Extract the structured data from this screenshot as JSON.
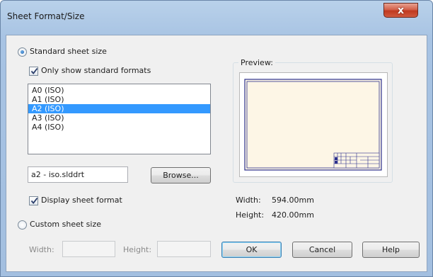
{
  "window": {
    "title": "Sheet Format/Size",
    "close_glyph": "x"
  },
  "standard": {
    "radio_label": "Standard sheet size",
    "selected": true,
    "only_standard_label": "Only show standard formats",
    "only_standard_checked": true,
    "formats": [
      "A0 (ISO)",
      "A1 (ISO)",
      "A2 (ISO)",
      "A3 (ISO)",
      "A4 (ISO)"
    ],
    "selected_format": "A2 (ISO)",
    "template_file": "a2 - iso.slddrt",
    "browse_label": "Browse...",
    "display_format_label": "Display sheet format",
    "display_format_checked": true
  },
  "custom": {
    "radio_label": "Custom sheet size",
    "selected": false,
    "width_label": "Width:",
    "height_label": "Height:",
    "width_value": "",
    "height_value": ""
  },
  "preview": {
    "label": "Preview:",
    "width_label": "Width:",
    "width_value": "594.00mm",
    "height_label": "Height:",
    "height_value": "420.00mm",
    "sheet_color": "#fdf6e6",
    "border_color": "#2b2f8c"
  },
  "buttons": {
    "ok": "OK",
    "cancel": "Cancel",
    "help": "Help"
  },
  "icons": {
    "close": "close-icon",
    "checkmark": "checkmark-icon"
  }
}
